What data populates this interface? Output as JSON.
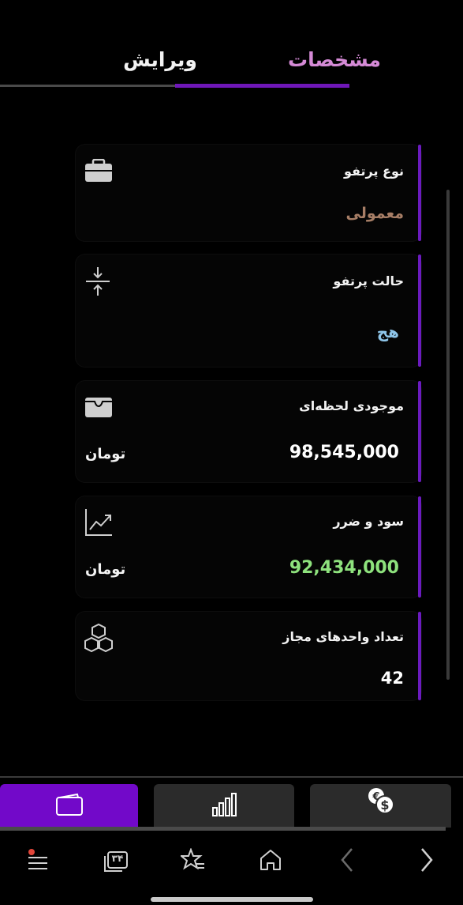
{
  "tabs": {
    "details": "مشخصات",
    "edit": "ویرایش"
  },
  "cards": {
    "portfolio_type": {
      "label": "نوع پرتفو",
      "value": "معمولی",
      "value_color": "#a77e66"
    },
    "portfolio_state": {
      "label": "حالت پرتفو",
      "value": "هج",
      "value_color": "#8fc6ea"
    },
    "live_balance": {
      "label": "موجودی لحظه‌ای",
      "value": "98,545,000",
      "unit": "تومان",
      "value_color": "#ffffff"
    },
    "profit_loss": {
      "label": "سود و ضرر",
      "value": "92,434,000",
      "unit": "تومان",
      "value_color": "#8ee27d"
    },
    "allowed_units": {
      "label": "تعداد واحدهای مجاز",
      "value": "42",
      "value_color": "#ffffff"
    }
  },
  "bottom_tabs": {
    "active_color": "#7209c9",
    "inactive_color": "#2b2b2b"
  },
  "browser_nav": {
    "tabs_count": "۳۴"
  },
  "icons": [
    "briefcase-icon",
    "compress-icon",
    "wallet-icon",
    "trend-icon",
    "cubes-icon",
    "card-icon",
    "bar-chart-icon",
    "currency-exchange-icon",
    "menu-icon",
    "tabs-icon",
    "star-list-icon",
    "home-icon",
    "back-icon",
    "forward-icon"
  ]
}
